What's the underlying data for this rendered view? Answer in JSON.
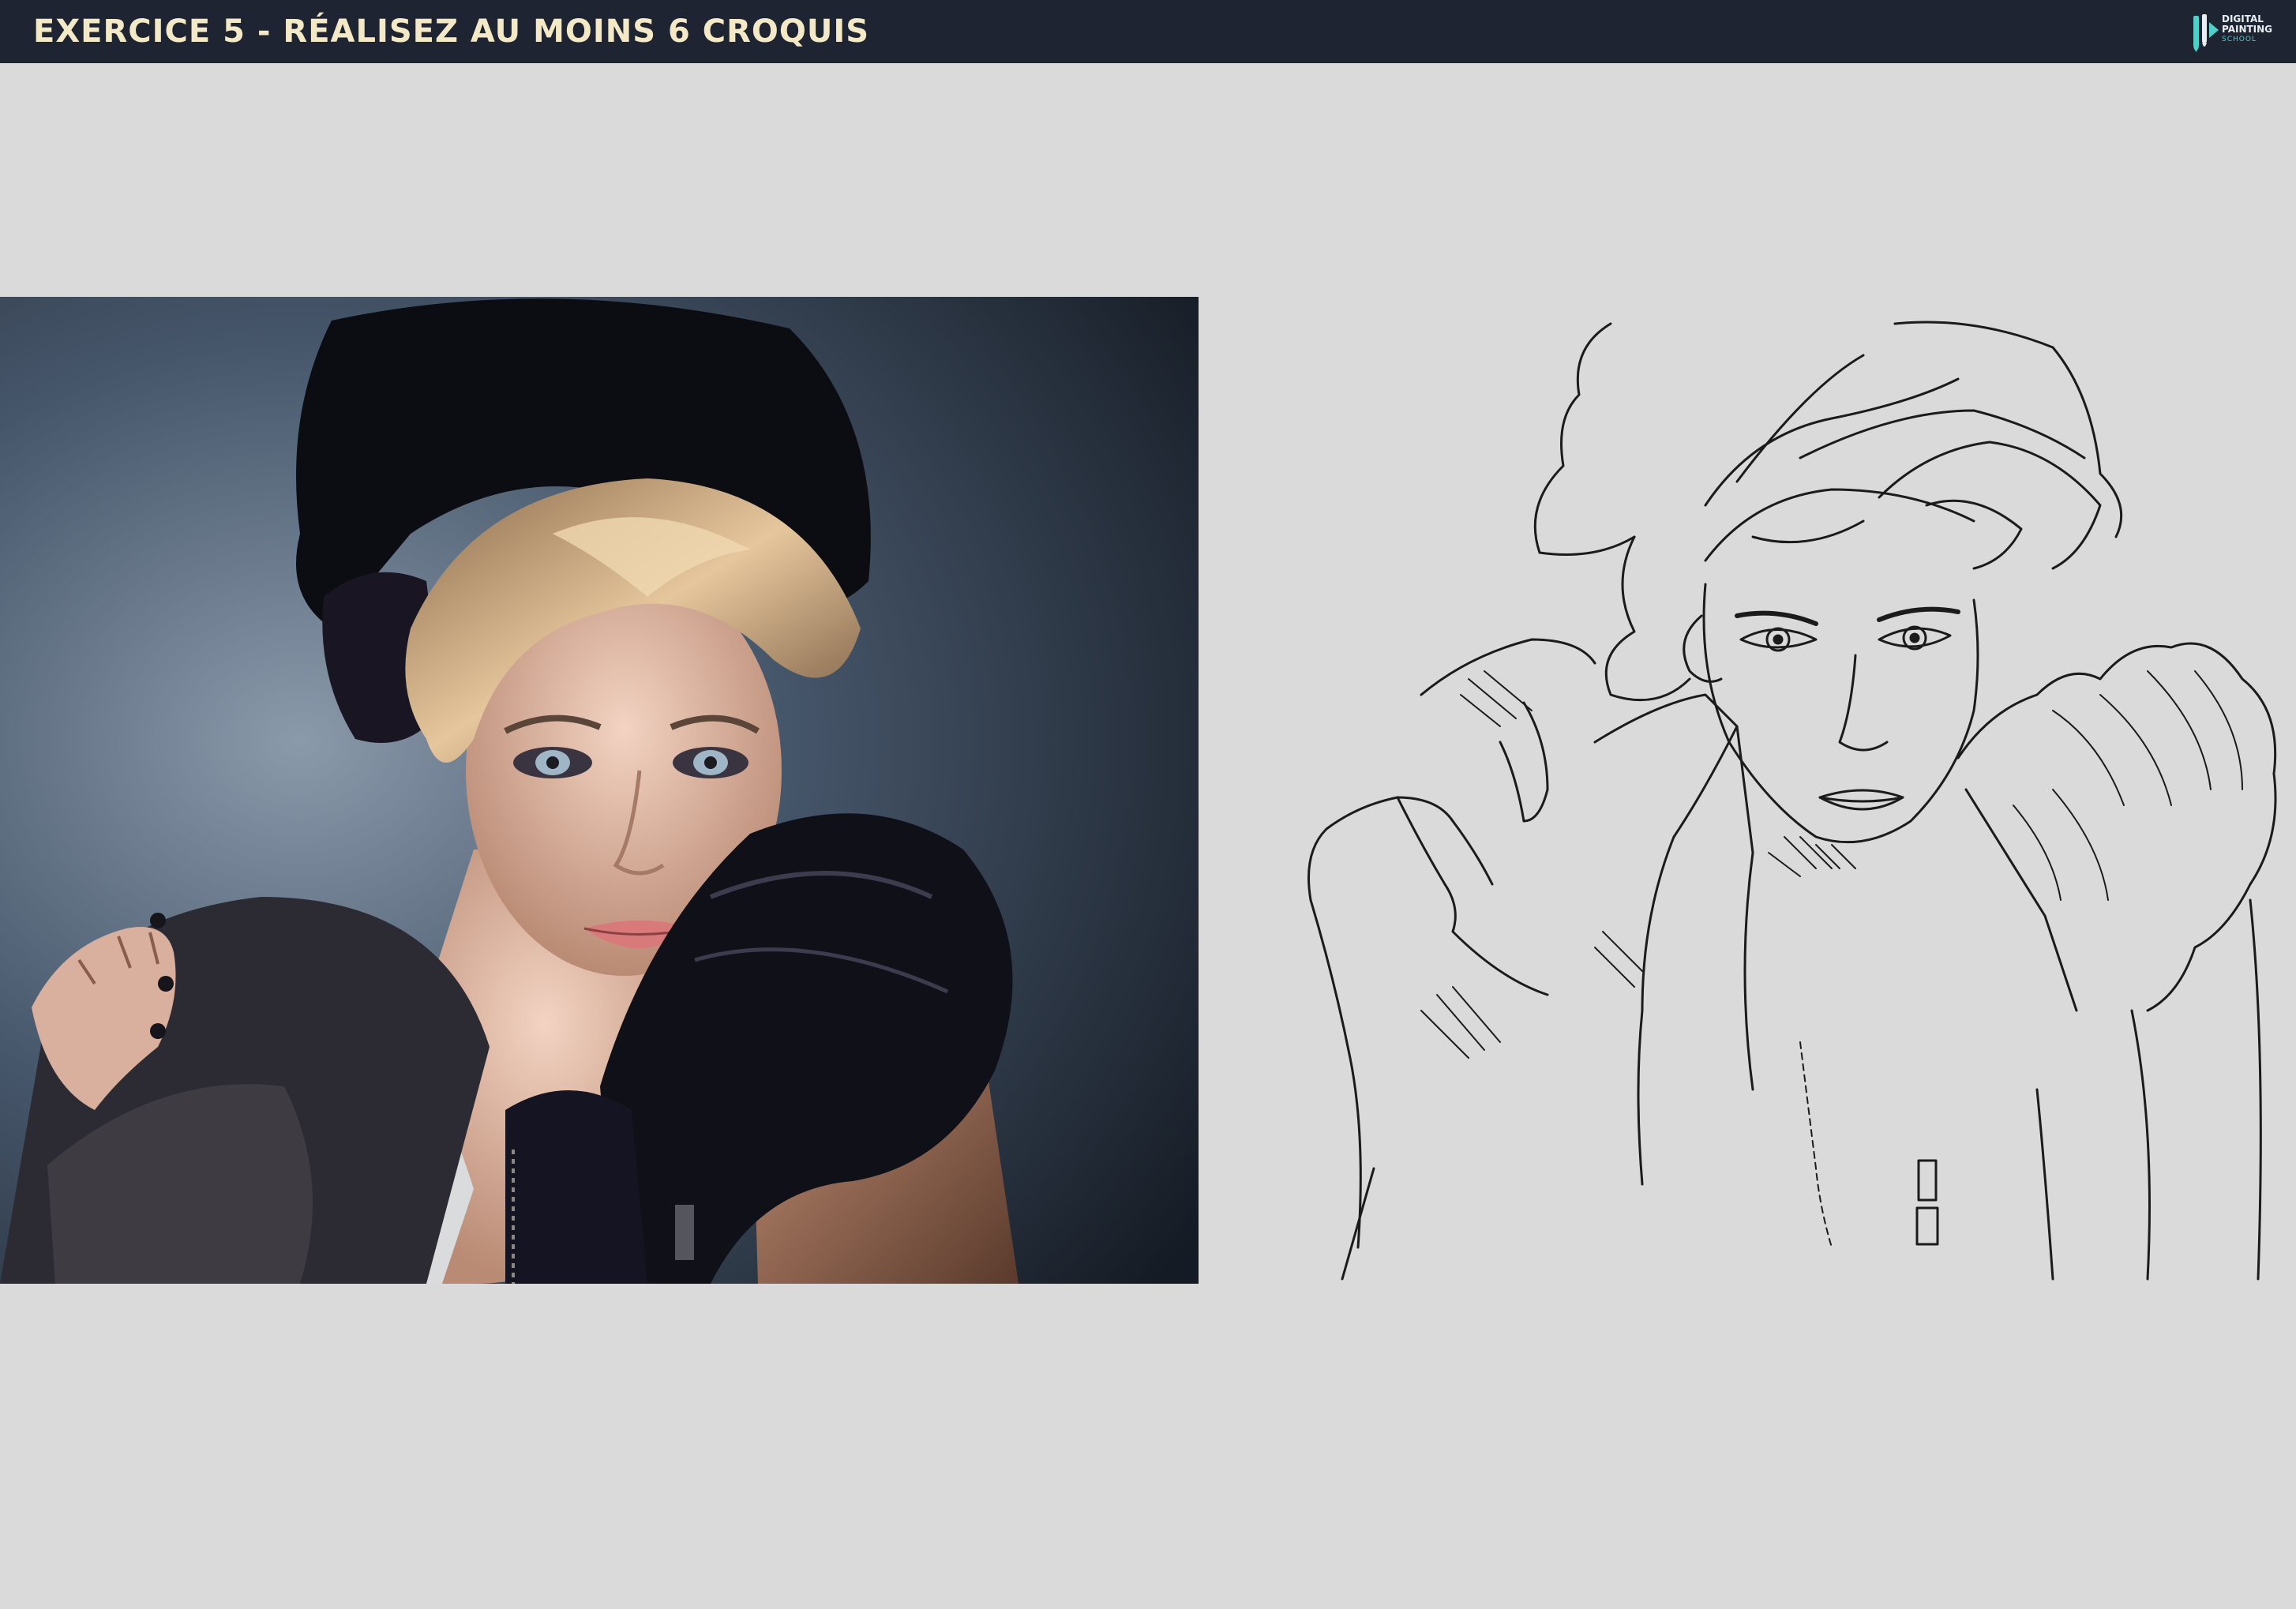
{
  "header": {
    "title": "EXERCICE 5 - RÉALISEZ AU MOINS 6 CROQUIS",
    "logo": {
      "line1": "DIGITAL",
      "line2": "PAINTING",
      "line3": "SCHOOL",
      "icon": "pencil-brush-logo-icon"
    }
  },
  "colors": {
    "header_bg": "#1f2433",
    "title": "#f3e9c6",
    "page_bg": "#dadada",
    "accent": "#4fd0c8"
  },
  "reference_photo": {
    "description_icon": "portrait-photo"
  },
  "sketch": {
    "description_icon": "line-drawing"
  }
}
